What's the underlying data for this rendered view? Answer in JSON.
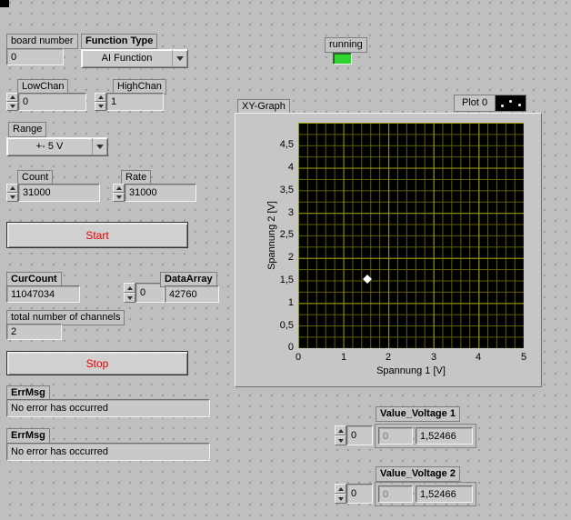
{
  "colors": {
    "background": "#bfbfbf",
    "plot_background": "#000000",
    "grid_major": "#9a9a00",
    "grid_minor": "#5f5f00",
    "button_text": "#e60000",
    "led_on": "#2fd52f",
    "marker": "#ffffff"
  },
  "controls": {
    "board_number": {
      "label": "board number",
      "value": "0"
    },
    "function_type": {
      "label": "Function Type",
      "value": "AI Function"
    },
    "low_chan": {
      "label": "LowChan",
      "value": "0"
    },
    "high_chan": {
      "label": "HighChan",
      "value": "1"
    },
    "range": {
      "label": "Range",
      "value": "+- 5 V"
    },
    "count": {
      "label": "Count",
      "value": "31000"
    },
    "rate": {
      "label": "Rate",
      "value": "31000"
    },
    "start_button": "Start",
    "stop_button": "Stop"
  },
  "indicators": {
    "running": {
      "label": "running",
      "on": true
    },
    "cur_count": {
      "label": "CurCount",
      "value": "11047034"
    },
    "data_array": {
      "label": "DataArray",
      "index": "0",
      "value": "42760"
    },
    "total_channels": {
      "label": "total number of channels",
      "value": "2"
    },
    "err_msg_1": {
      "label": "ErrMsg",
      "value": "No error has occurred"
    },
    "err_msg_2": {
      "label": "ErrMsg",
      "value": "No error has occurred"
    },
    "value_voltage_1": {
      "label": "Value_Voltage 1",
      "index": "0",
      "element": "0",
      "value": "1,52466"
    },
    "value_voltage_2": {
      "label": "Value_Voltage 2",
      "index": "0",
      "element": "0",
      "value": "1,52466"
    }
  },
  "graph": {
    "title": "XY-Graph",
    "plot_name": "Plot 0",
    "x_label": "Spannung 1 [V]",
    "y_label": "Spannung 2 [V]",
    "x_ticks": [
      "0",
      "1",
      "2",
      "3",
      "4",
      "5"
    ],
    "y_ticks": [
      "4,5",
      "4",
      "3,5",
      "3",
      "2,5",
      "2",
      "1,5",
      "1",
      "0,5",
      "0"
    ]
  },
  "chart_data": {
    "type": "scatter",
    "title": "XY-Graph",
    "xlabel": "Spannung 1 [V]",
    "ylabel": "Spannung 2 [V]",
    "xlim": [
      0,
      5
    ],
    "ylim": [
      0,
      5
    ],
    "grid": true,
    "legend_position": "top-right",
    "series": [
      {
        "name": "Plot 0",
        "marker": "diamond",
        "color": "#ffffff",
        "points": [
          {
            "x": 1.52466,
            "y": 1.52466
          }
        ]
      }
    ]
  }
}
